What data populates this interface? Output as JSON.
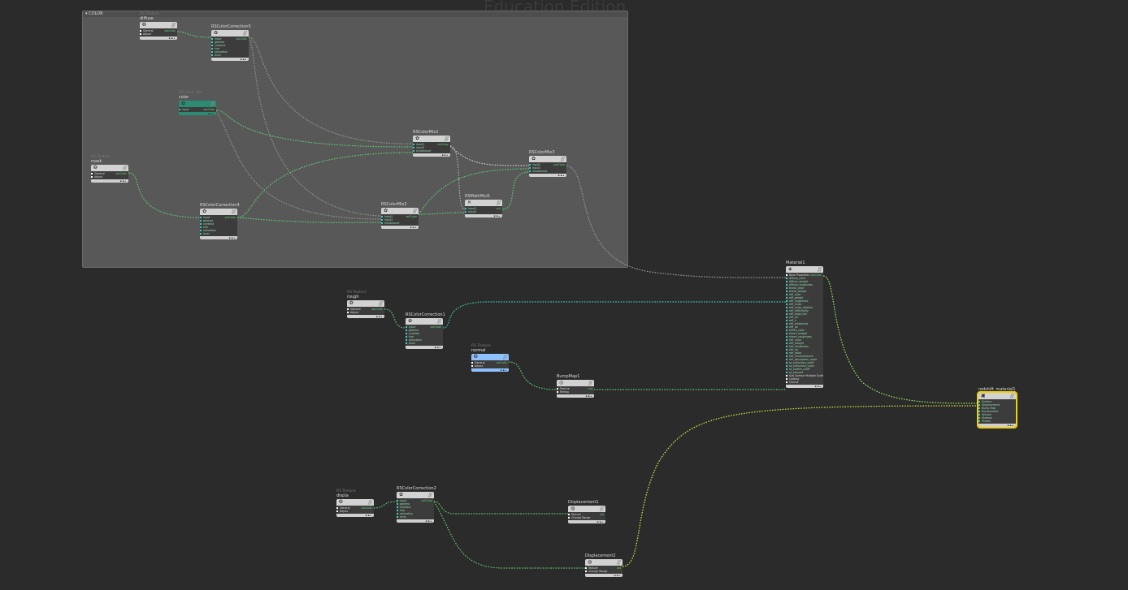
{
  "watermark": "Education Edition",
  "network_box": {
    "label": "COLOR"
  },
  "colors": {
    "background": "#2b2b2b",
    "network_box": "#585858",
    "wire_green": "#5fc878",
    "wire_teal": "#3ec9b5",
    "wire_yellow": "#d8e040",
    "selected": "#f0d000"
  },
  "nodes": [
    {
      "id": "diffuse",
      "type": "RS Texture",
      "name": "diffuse",
      "icon": "texture-icon",
      "inputs": [
        "General",
        "Adjust"
      ],
      "output": "outColor",
      "style": "",
      "white": true
    },
    {
      "id": "cc5",
      "type": "",
      "name": "RSColorCorrection5",
      "icon": "color-wheel-icon",
      "inputs": [
        "input",
        "gamma",
        "contrast",
        "hue",
        "saturation",
        "level"
      ],
      "output": "outColor",
      "style": ""
    },
    {
      "id": "color",
      "type": "RS Color Abs",
      "name": "color",
      "icon": "color-wheel-icon",
      "inputs": [
        "input"
      ],
      "output": "outColor",
      "style": "teal"
    },
    {
      "id": "mask",
      "type": "RS Texture",
      "name": "mask",
      "icon": "texture-icon",
      "inputs": [
        "General",
        "Adjust"
      ],
      "output": "outColor",
      "style": "",
      "white": true
    },
    {
      "id": "mix1",
      "type": "",
      "name": "RSColorMix1",
      "icon": "color-wheel-icon",
      "inputs": [
        "input1",
        "input2",
        "mixAmount"
      ],
      "output": "outColor",
      "style": ""
    },
    {
      "id": "mix3",
      "type": "",
      "name": "RSColorMix3",
      "icon": "color-wheel-icon",
      "inputs": [
        "input1",
        "input2",
        "mixAmount"
      ],
      "output": "outColor",
      "style": ""
    },
    {
      "id": "cc4",
      "type": "",
      "name": "RSColorCorrection4",
      "icon": "color-wheel-icon",
      "inputs": [
        "input",
        "gamma",
        "contrast",
        "hue",
        "saturation",
        "level"
      ],
      "output": "outColor",
      "style": ""
    },
    {
      "id": "mix2",
      "type": "",
      "name": "RSColorMix2",
      "icon": "color-wheel-icon",
      "inputs": [
        "input1",
        "input2",
        "mixAmount"
      ],
      "output": "outColor",
      "style": ""
    },
    {
      "id": "mul1",
      "type": "",
      "name": "RSMathMul1",
      "icon": "multiply-icon",
      "inputs": [
        "input1",
        "input2"
      ],
      "output": "out",
      "style": ""
    },
    {
      "id": "mat1",
      "type": "",
      "name": "Material1",
      "icon": "material-icon",
      "inputs": [
        "Base Properties",
        "diffuse_color",
        "diffuse_weight",
        "diffuse_roughness",
        "transl_color",
        "transl_weight",
        "refl_color",
        "refl_weight",
        "refl_roughness",
        "refl_aniso",
        "refl_aniso_rotation",
        "refl_reflectivity",
        "refl_edge_tint",
        "refl_ior",
        "refl_k",
        "refl_metalness",
        "refl_ior",
        "sheen_color",
        "sheen_weight",
        "sheen_roughness",
        "refr_color",
        "refr_weight",
        "refr_roughness",
        "refr_ior",
        "refr_abbe",
        "refr_transmittance",
        "refr_absorption_scale",
        "ss_extinction_coeff",
        "ss_extinction_scale",
        "ss_scatter_coeff",
        "ss_amount",
        "Sub Surface Multiple Scattering",
        "Coating",
        "Overall"
      ],
      "output": "outColor",
      "style": ""
    },
    {
      "id": "rough",
      "type": "RS Texture",
      "name": "rough",
      "icon": "texture-icon",
      "inputs": [
        "General",
        "Adjust"
      ],
      "output": "outColor",
      "style": "",
      "white": true
    },
    {
      "id": "cc1",
      "type": "",
      "name": "RSColorCorrection1",
      "icon": "color-wheel-icon",
      "inputs": [
        "input",
        "gamma",
        "contrast",
        "hue",
        "saturation",
        "level"
      ],
      "output": "outColor",
      "style": ""
    },
    {
      "id": "normal",
      "type": "RS Texture",
      "name": "normal",
      "icon": "texture-icon",
      "inputs": [
        "General",
        "Adjust"
      ],
      "output": "outColor",
      "style": "blue",
      "white": true
    },
    {
      "id": "bump1",
      "type": "",
      "name": "BumpMap1",
      "icon": "bump-icon",
      "inputs": [
        "Texture",
        "Remap"
      ],
      "output": "out",
      "style": "",
      "white": true
    },
    {
      "id": "rsmat",
      "type": "",
      "name": "redshift_material1",
      "icon": "output-icon",
      "inputs": [
        "Surface",
        "Displacement",
        "Bump Map",
        "Environment",
        "Volume",
        "Shadow",
        "Photon"
      ],
      "output": "",
      "style": "sel"
    },
    {
      "id": "displa",
      "type": "RS Texture",
      "name": "displa",
      "icon": "texture-icon",
      "inputs": [
        "General",
        "Adjust"
      ],
      "output": "outColor",
      "style": "",
      "white": true
    },
    {
      "id": "cc2",
      "type": "",
      "name": "RSColorCorrection2",
      "icon": "color-wheel-icon",
      "inputs": [
        "input",
        "gamma",
        "contrast",
        "hue",
        "saturation",
        "level"
      ],
      "output": "outColor",
      "style": ""
    },
    {
      "id": "disp1",
      "type": "",
      "name": "Displacement1",
      "icon": "displacement-icon",
      "inputs": [
        "Texture",
        "Change Range"
      ],
      "output": "out",
      "style": "",
      "white": true
    },
    {
      "id": "disp2",
      "type": "",
      "name": "Displacement2",
      "icon": "displacement-icon",
      "inputs": [
        "Texture",
        "Change Range"
      ],
      "output": "out",
      "style": "",
      "white": true
    }
  ]
}
